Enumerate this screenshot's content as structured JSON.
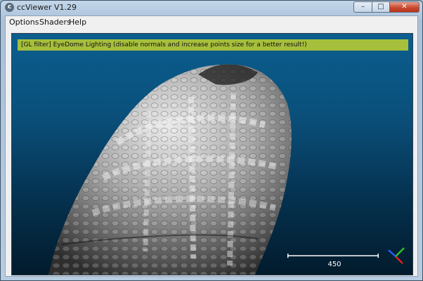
{
  "window": {
    "title": "ccViewer V1.29",
    "icon_letter": "c",
    "minimize_glyph": "–",
    "maximize_glyph": "□",
    "close_glyph": "✕"
  },
  "menu": {
    "items": [
      {
        "label": "Options"
      },
      {
        "label": "Shaders"
      },
      {
        "label": "Help"
      }
    ]
  },
  "viewer": {
    "filter_message": "[GL filter] EyeDome Lighting (disable normals and increase points size for a better result!)",
    "scale_label": "450",
    "background_top": "#0b5e8f",
    "background_bottom": "#021b2c",
    "banner_color": "#a6bf3c",
    "axes_colors": {
      "x": "#e02020",
      "y": "#29c329",
      "z": "#2a5bff"
    }
  }
}
